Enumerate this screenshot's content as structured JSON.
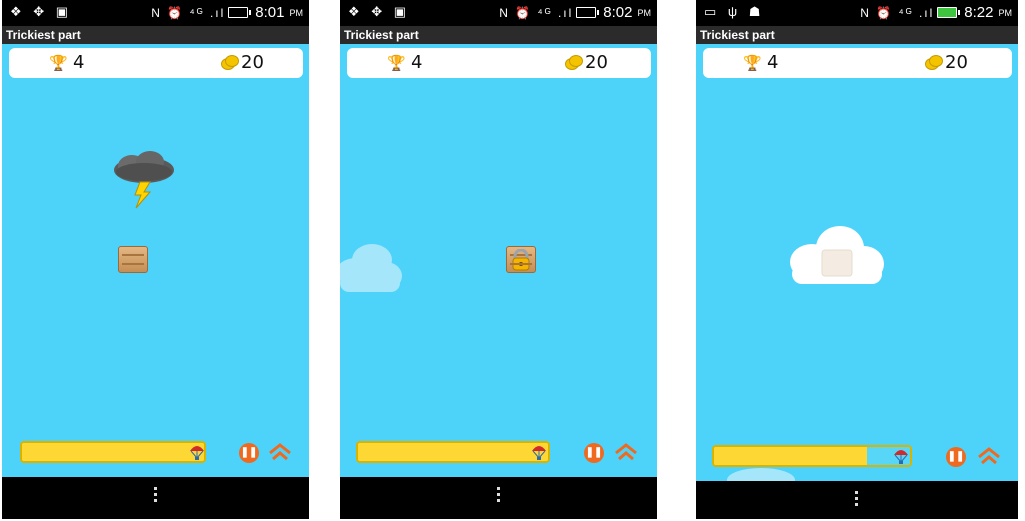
{
  "screens": [
    {
      "status": {
        "left_icons": "❖ ✥ ▣",
        "right_icons": "N ⏰ ⁴ᴳ .ıl",
        "time": "8:01",
        "ampm": "PM",
        "battery": "normal"
      },
      "title": "Trickiest part",
      "score": "4",
      "coins": "20",
      "progress_fraction": 1.0,
      "objects": [
        "storm-cloud",
        "crate"
      ]
    },
    {
      "status": {
        "left_icons": "❖ ✥ ▣",
        "right_icons": "N ⏰ ⁴ᴳ .ıl",
        "time": "8:02",
        "ampm": "PM",
        "battery": "normal"
      },
      "title": "Trickiest part",
      "score": "4",
      "coins": "20",
      "progress_fraction": 1.0,
      "objects": [
        "cloud",
        "locked-crate"
      ]
    },
    {
      "status": {
        "left_icons": "▭ ψ ☗",
        "right_icons": "N ⏰ ⁴ᴳ .ıl",
        "time": "8:22",
        "ampm": "PM",
        "battery": "charging"
      },
      "title": "Trickiest part",
      "score": "4",
      "coins": "20",
      "progress_fraction": 0.78,
      "objects": [
        "cloud-with-crate"
      ]
    }
  ],
  "icons": {
    "trophy": "trophy-icon",
    "coins": "coin-stack-icon",
    "parachute": "parachute-icon",
    "pause": "pause-icon",
    "home": "home-icon",
    "menu": "overflow-menu-icon"
  },
  "colors": {
    "sky": "#4dd2fa",
    "progress": "#fdd835",
    "accent": "#ef6a1f",
    "coin": "#f5c400"
  }
}
